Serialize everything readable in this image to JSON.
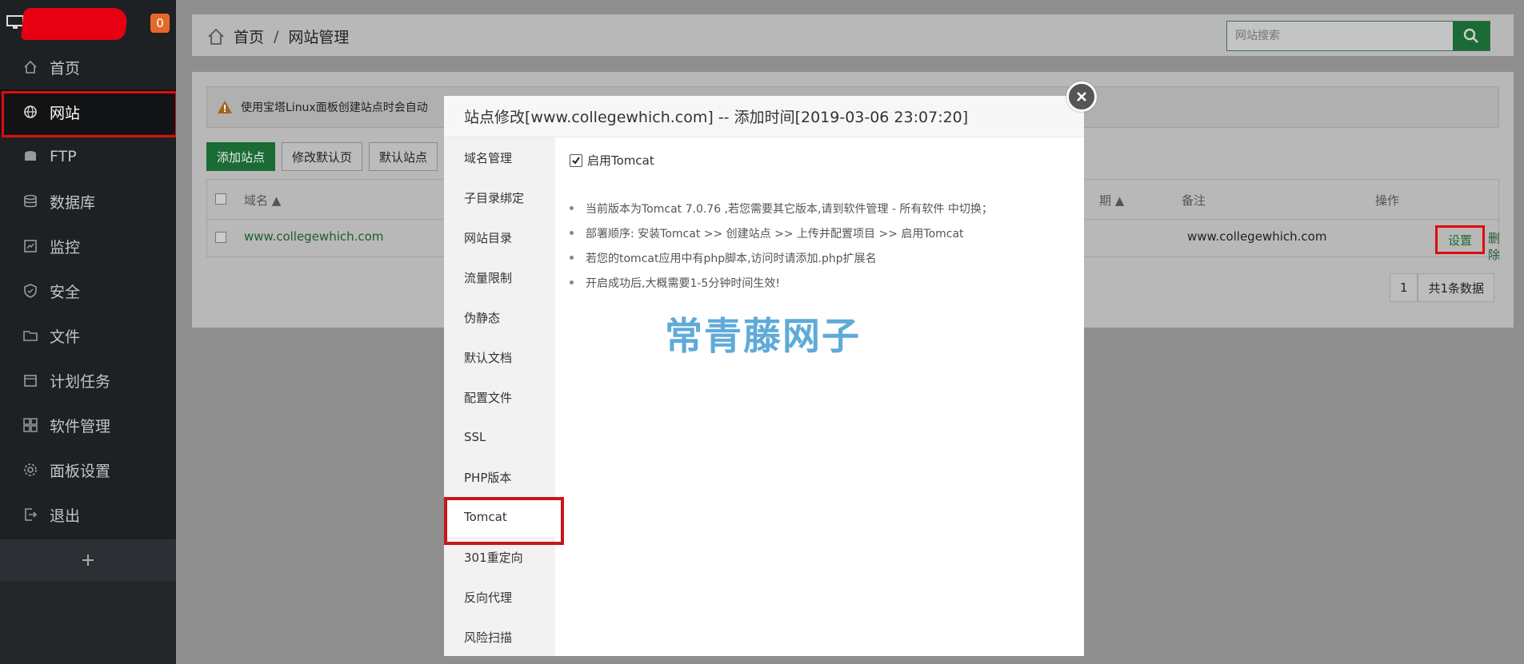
{
  "sidebar": {
    "notification_count": "0",
    "items": [
      {
        "label": "首页",
        "icon": "home-icon"
      },
      {
        "label": "网站",
        "icon": "globe-icon"
      },
      {
        "label": "FTP",
        "icon": "ftp-icon"
      },
      {
        "label": "数据库",
        "icon": "database-icon"
      },
      {
        "label": "监控",
        "icon": "monitor-chart-icon"
      },
      {
        "label": "安全",
        "icon": "shield-icon"
      },
      {
        "label": "文件",
        "icon": "folder-icon"
      },
      {
        "label": "计划任务",
        "icon": "calendar-icon"
      },
      {
        "label": "软件管理",
        "icon": "grid-icon"
      },
      {
        "label": "面板设置",
        "icon": "gear-icon"
      },
      {
        "label": "退出",
        "icon": "logout-icon"
      }
    ],
    "active_index": 1,
    "add_label": "+"
  },
  "header": {
    "breadcrumb_home": "首页",
    "breadcrumb_sep": "/",
    "breadcrumb_current": "网站管理",
    "search_placeholder": "网站搜索"
  },
  "page": {
    "alert_text": "使用宝塔Linux面板创建站点时会自动",
    "buttons": {
      "add_site": "添加站点",
      "edit_default_page": "修改默认页",
      "default_site": "默认站点"
    },
    "table": {
      "headers": {
        "domain": "域名 ▲",
        "expire": "期 ▲",
        "remark": "备注",
        "action": "操作"
      },
      "rows": [
        {
          "domain": "www.collegewhich.com",
          "remark": "www.collegewhich.com",
          "settings": "设置",
          "delete": "删除"
        }
      ]
    },
    "pager": {
      "page": "1",
      "total": "共1条数据"
    }
  },
  "modal": {
    "title": "站点修改[www.collegewhich.com] -- 添加时间[2019-03-06 23:07:20]",
    "nav": [
      "域名管理",
      "子目录绑定",
      "网站目录",
      "流量限制",
      "伪静态",
      "默认文档",
      "配置文件",
      "SSL",
      "PHP版本",
      "Tomcat",
      "301重定向",
      "反向代理",
      "风险扫描"
    ],
    "active_nav_index": 9,
    "enable_label": "启用Tomcat",
    "enable_checked": true,
    "tips": [
      "当前版本为Tomcat 7.0.76 ,若您需要其它版本,请到软件管理 - 所有软件 中切换；",
      "部署顺序: 安装Tomcat >> 创建站点 >> 上传并配置项目 >> 启用Tomcat",
      "若您的tomcat应用中有php脚本,访问时请添加.php扩展名",
      "开启成功后,大概需要1-5分钟时间生效!"
    ],
    "watermark": "常青藤网子"
  },
  "colors": {
    "sidebar_bg": "#1e2124",
    "accent_green": "#20a53a",
    "highlight_red": "#e10b0b",
    "badge_orange": "#e5682a",
    "watermark_blue": "#5faad8"
  }
}
